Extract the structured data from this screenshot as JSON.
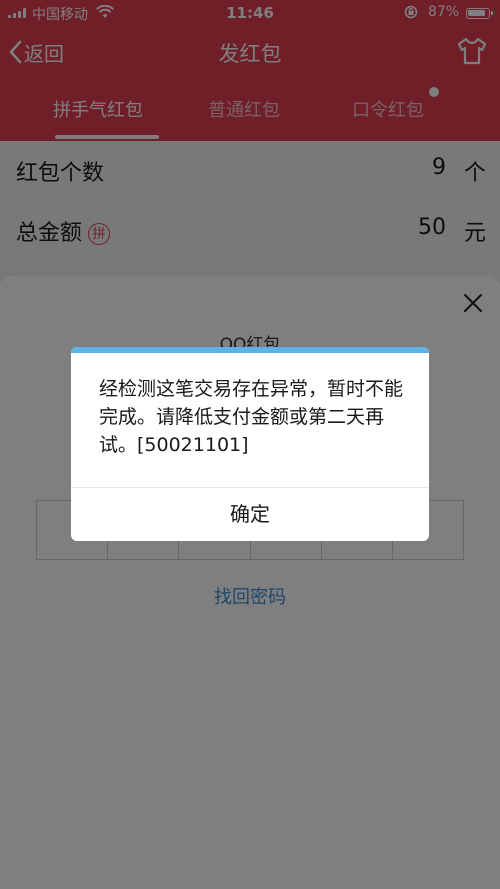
{
  "status_bar": {
    "carrier": "中国移动",
    "time": "11:46",
    "battery_percent": "87%",
    "battery_level": 0.87
  },
  "nav": {
    "back_label": "返回",
    "title": "发红包"
  },
  "tabs": [
    {
      "label": "拼手气红包",
      "active": true
    },
    {
      "label": "普通红包",
      "active": false
    },
    {
      "label": "口令红包",
      "active": false
    }
  ],
  "form": {
    "count_label": "红包个数",
    "count_value": "9",
    "count_unit": "个",
    "amount_label": "总金额",
    "amount_badge": "拼",
    "amount_value": "50",
    "amount_unit": "元"
  },
  "pay_sheet": {
    "title": "QQ红包",
    "forgot_password": "找回密码"
  },
  "alert": {
    "message": "经检测这笔交易存在异常，暂时不能完成。请降低支付金额或第二天再试。[50021101]",
    "confirm_label": "确定"
  },
  "colors": {
    "brand": "#e03e52",
    "alert_accent": "#5cb3e6",
    "link": "#3b8fd6"
  }
}
